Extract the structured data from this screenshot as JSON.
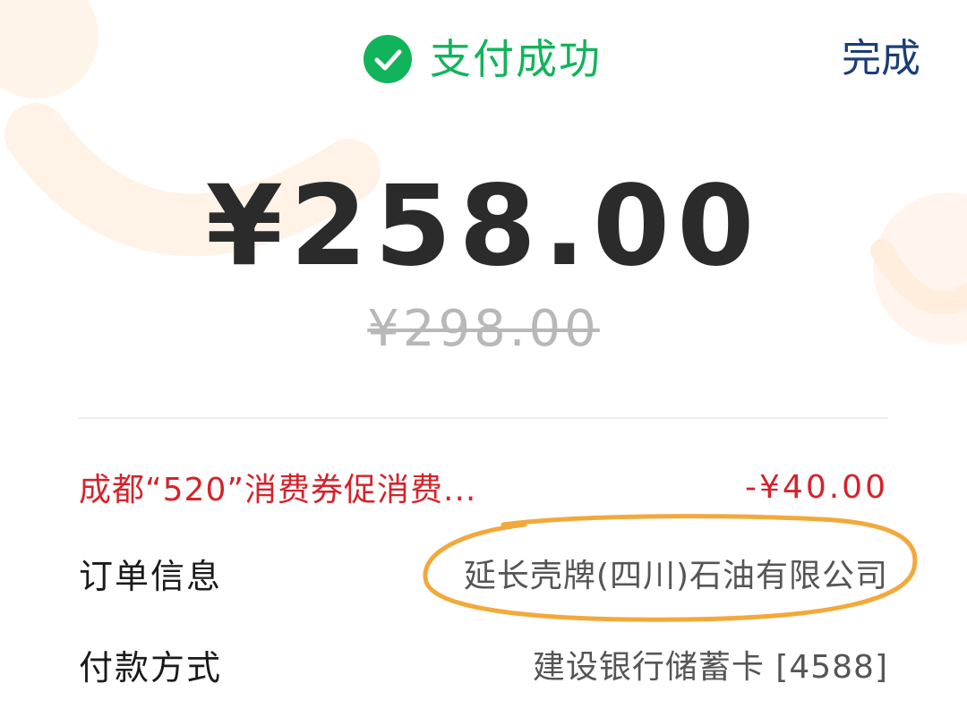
{
  "header": {
    "status": "支付成功",
    "done_label": "完成",
    "check_icon": "check-circle-icon",
    "status_color": "#11b45a"
  },
  "payment": {
    "amount": "¥258.00",
    "original_amount": "¥298.00"
  },
  "details": {
    "promo": {
      "label": "成都“520”消费券促消费...",
      "value": "-¥40.00",
      "color": "#d4232b"
    },
    "order": {
      "label": "订单信息",
      "value": "延长壳牌(四川)石油有限公司"
    },
    "payment_method": {
      "label": "付款方式",
      "value": "建设银行储蓄卡 [4588]"
    }
  },
  "annotation": {
    "color": "#f2a93b"
  }
}
